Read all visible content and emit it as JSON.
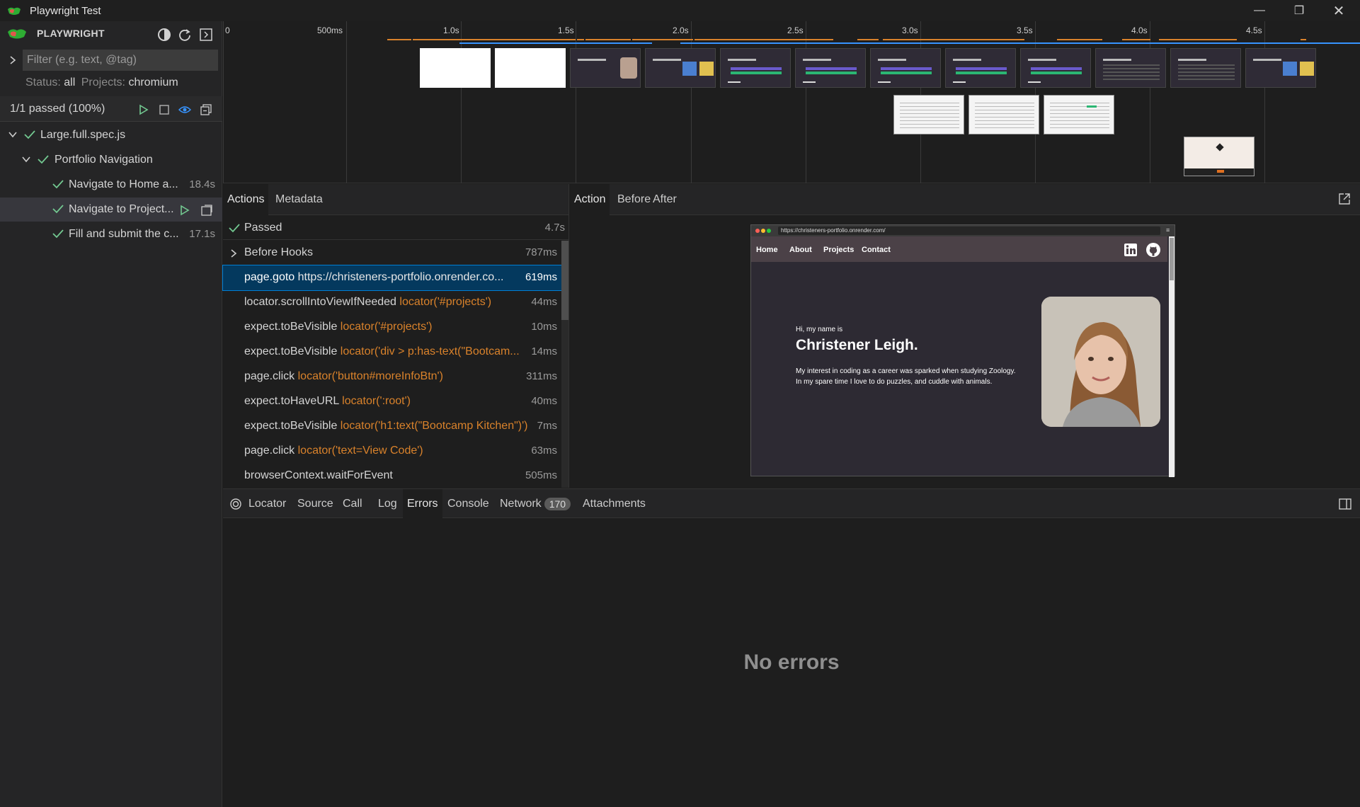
{
  "window": {
    "title": "Playwright Test"
  },
  "sidebar": {
    "brand": "PLAYWRIGHT",
    "filter_placeholder": "Filter (e.g. text, @tag)",
    "status_label": "Status:",
    "status_value": "all",
    "projects_label": "Projects:",
    "projects_value": "chromium",
    "passed_summary": "1/1 passed (100%)",
    "tree": {
      "file": "Large.full.spec.js",
      "suite": "Portfolio Navigation",
      "tests": [
        {
          "label": "Navigate to Home a...",
          "duration": "18.4s"
        },
        {
          "label": "Navigate to Project...",
          "duration": ""
        },
        {
          "label": "Fill and submit the c...",
          "duration": "17.1s"
        }
      ]
    }
  },
  "timeline": {
    "ticks": [
      "0",
      "500ms",
      "1.0s",
      "1.5s",
      "2.0s",
      "2.5s",
      "3.0s",
      "3.5s",
      "4.0s",
      "4.5s"
    ]
  },
  "actions_panel": {
    "tabs": [
      "Actions",
      "Metadata"
    ],
    "status": "Passed",
    "status_duration": "4.7s",
    "rows": [
      {
        "name": "Before Hooks",
        "arg": "",
        "duration": "787ms"
      },
      {
        "name": "page.goto",
        "arg": "https://christeners-portfolio.onrender.co...",
        "duration": "619ms"
      },
      {
        "name": "locator.scrollIntoViewIfNeeded",
        "arg": "locator('#projects')",
        "duration": "44ms"
      },
      {
        "name": "expect.toBeVisible",
        "arg": "locator('#projects')",
        "duration": "10ms"
      },
      {
        "name": "expect.toBeVisible",
        "arg": "locator('div > p:has-text(\"Bootcam...",
        "duration": "14ms"
      },
      {
        "name": "page.click",
        "arg": "locator('button#moreInfoBtn')",
        "duration": "311ms"
      },
      {
        "name": "expect.toHaveURL",
        "arg": "locator(':root')",
        "duration": "40ms"
      },
      {
        "name": "expect.toBeVisible",
        "arg": "locator('h1:text(\"Bootcamp Kitchen\")')",
        "duration": "7ms"
      },
      {
        "name": "page.click",
        "arg": "locator('text=View Code')",
        "duration": "63ms"
      },
      {
        "name": "browserContext.waitForEvent",
        "arg": "",
        "duration": "505ms"
      }
    ]
  },
  "snapshot_panel": {
    "tabs": [
      "Action",
      "Before",
      "After"
    ],
    "browser_url": "https://christeners-portfolio.onrender.com/",
    "nav_links": [
      "Home",
      "About",
      "Projects",
      "Contact"
    ],
    "hero_greeting": "Hi, my name is",
    "hero_name": "Christener Leigh.",
    "hero_desc": "My interest in coding as a career was sparked when studying Zoology. In my spare time I love to do puzzles, and cuddle with animals."
  },
  "bottom_tabs": {
    "tabs": [
      "Locator",
      "Source",
      "Call",
      "Log",
      "Errors",
      "Console",
      "Network",
      "Attachments"
    ],
    "network_count": "170"
  },
  "errors": {
    "message": "No errors"
  },
  "colors": {
    "accent_blue": "#3794ff",
    "accent_orange": "#d9822b",
    "pass_green": "#73c991"
  }
}
